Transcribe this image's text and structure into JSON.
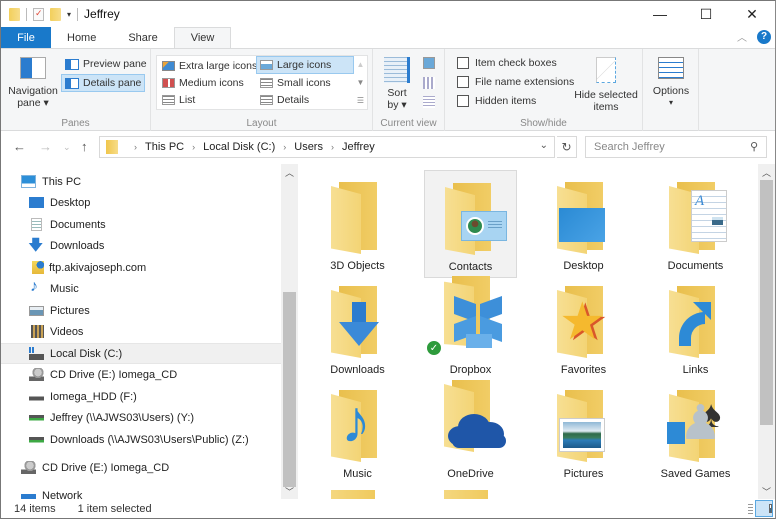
{
  "window": {
    "title": "Jeffrey",
    "controls": {
      "minimize": "—",
      "maximize": "☐",
      "close": "✕"
    }
  },
  "tabs": [
    {
      "label": "File",
      "active": false
    },
    {
      "label": "Home",
      "active": false
    },
    {
      "label": "Share",
      "active": false
    },
    {
      "label": "View",
      "active": true
    }
  ],
  "help_label": "?",
  "ribbon": {
    "panes": {
      "label": "Panes",
      "navigation_pane": "Navigation",
      "navigation_pane_line2": "pane ▾",
      "preview_pane": "Preview pane",
      "details_pane": "Details pane",
      "details_pane_selected": true
    },
    "layout": {
      "label": "Layout",
      "options": [
        {
          "label": "Extra large icons",
          "icon": "extra-large-icons-icon",
          "selected": false
        },
        {
          "label": "Large icons",
          "icon": "large-icons-icon",
          "selected": true
        },
        {
          "label": "Medium icons",
          "icon": "medium-icons-icon",
          "selected": false
        },
        {
          "label": "Small icons",
          "icon": "small-icons-icon",
          "selected": false
        },
        {
          "label": "List",
          "icon": "list-icon",
          "selected": false
        },
        {
          "label": "Details",
          "icon": "details-icon",
          "selected": false
        }
      ]
    },
    "current_view": {
      "label": "Current view",
      "sort_by": "Sort",
      "sort_by_line2": "by ▾"
    },
    "show_hide": {
      "label": "Show/hide",
      "checkboxes": [
        {
          "label": "Item check boxes",
          "checked": false
        },
        {
          "label": "File name extensions",
          "checked": false
        },
        {
          "label": "Hidden items",
          "checked": false
        }
      ],
      "hide_selected": "Hide selected",
      "hide_selected_line2": "items"
    },
    "options": {
      "label": "Options",
      "arrow": "▾"
    }
  },
  "address": {
    "breadcrumbs": [
      "This PC",
      "Local Disk (C:)",
      "Users",
      "Jeffrey"
    ],
    "search_placeholder": "Search Jeffrey"
  },
  "nav_pane": {
    "items": [
      {
        "label": "This PC",
        "icon": "this-pc-icon",
        "level": 0,
        "selected": false
      },
      {
        "label": "Desktop",
        "icon": "desktop-icon",
        "level": 1,
        "selected": false
      },
      {
        "label": "Documents",
        "icon": "documents-icon",
        "level": 1,
        "selected": false
      },
      {
        "label": "Downloads",
        "icon": "downloads-icon",
        "level": 1,
        "selected": false
      },
      {
        "label": "ftp.akivajoseph.com",
        "icon": "ftp-location-icon",
        "level": 1,
        "selected": false
      },
      {
        "label": "Music",
        "icon": "music-icon",
        "level": 1,
        "selected": false
      },
      {
        "label": "Pictures",
        "icon": "pictures-icon",
        "level": 1,
        "selected": false
      },
      {
        "label": "Videos",
        "icon": "videos-icon",
        "level": 1,
        "selected": false
      },
      {
        "label": "Local Disk (C:)",
        "icon": "local-disk-icon",
        "level": 1,
        "selected": true
      },
      {
        "label": "CD Drive (E:) Iomega_CD",
        "icon": "cd-drive-icon",
        "level": 1,
        "selected": false
      },
      {
        "label": "Iomega_HDD (F:)",
        "icon": "hard-drive-icon",
        "level": 1,
        "selected": false
      },
      {
        "label": "Jeffrey (\\\\AJWS03\\Users) (Y:)",
        "icon": "network-drive-icon",
        "level": 1,
        "selected": false
      },
      {
        "label": "Downloads (\\\\AJWS03\\Users\\Public) (Z:)",
        "icon": "network-drive-icon",
        "level": 1,
        "selected": false
      },
      {
        "label": "CD Drive (E:) Iomega_CD",
        "icon": "cd-drive-icon",
        "level": 0,
        "selected": false
      },
      {
        "label": "Network",
        "icon": "network-icon",
        "level": 0,
        "selected": false
      }
    ]
  },
  "content": {
    "items": [
      {
        "label": "3D Objects",
        "overlay": "none",
        "selected": false
      },
      {
        "label": "Contacts",
        "overlay": "contact-card",
        "selected": true
      },
      {
        "label": "Desktop",
        "overlay": "desktop",
        "selected": false
      },
      {
        "label": "Documents",
        "overlay": "document",
        "selected": false
      },
      {
        "label": "Downloads",
        "overlay": "download-arrow",
        "selected": false
      },
      {
        "label": "Dropbox",
        "overlay": "dropbox",
        "selected": false,
        "sync_status": "synced"
      },
      {
        "label": "Favorites",
        "overlay": "star",
        "selected": false
      },
      {
        "label": "Links",
        "overlay": "shortcut-arrow",
        "selected": false
      },
      {
        "label": "Music",
        "overlay": "music-note",
        "selected": false
      },
      {
        "label": "OneDrive",
        "overlay": "cloud",
        "selected": false
      },
      {
        "label": "Pictures",
        "overlay": "picture",
        "selected": false
      },
      {
        "label": "Saved Games",
        "overlay": "games",
        "selected": false
      }
    ]
  },
  "status": {
    "item_count": "14 items",
    "selection": "1 item selected"
  },
  "colors": {
    "accent": "#1979ca",
    "selection_bg": "#cce4f7",
    "folder_yellow": "#f3d475"
  }
}
